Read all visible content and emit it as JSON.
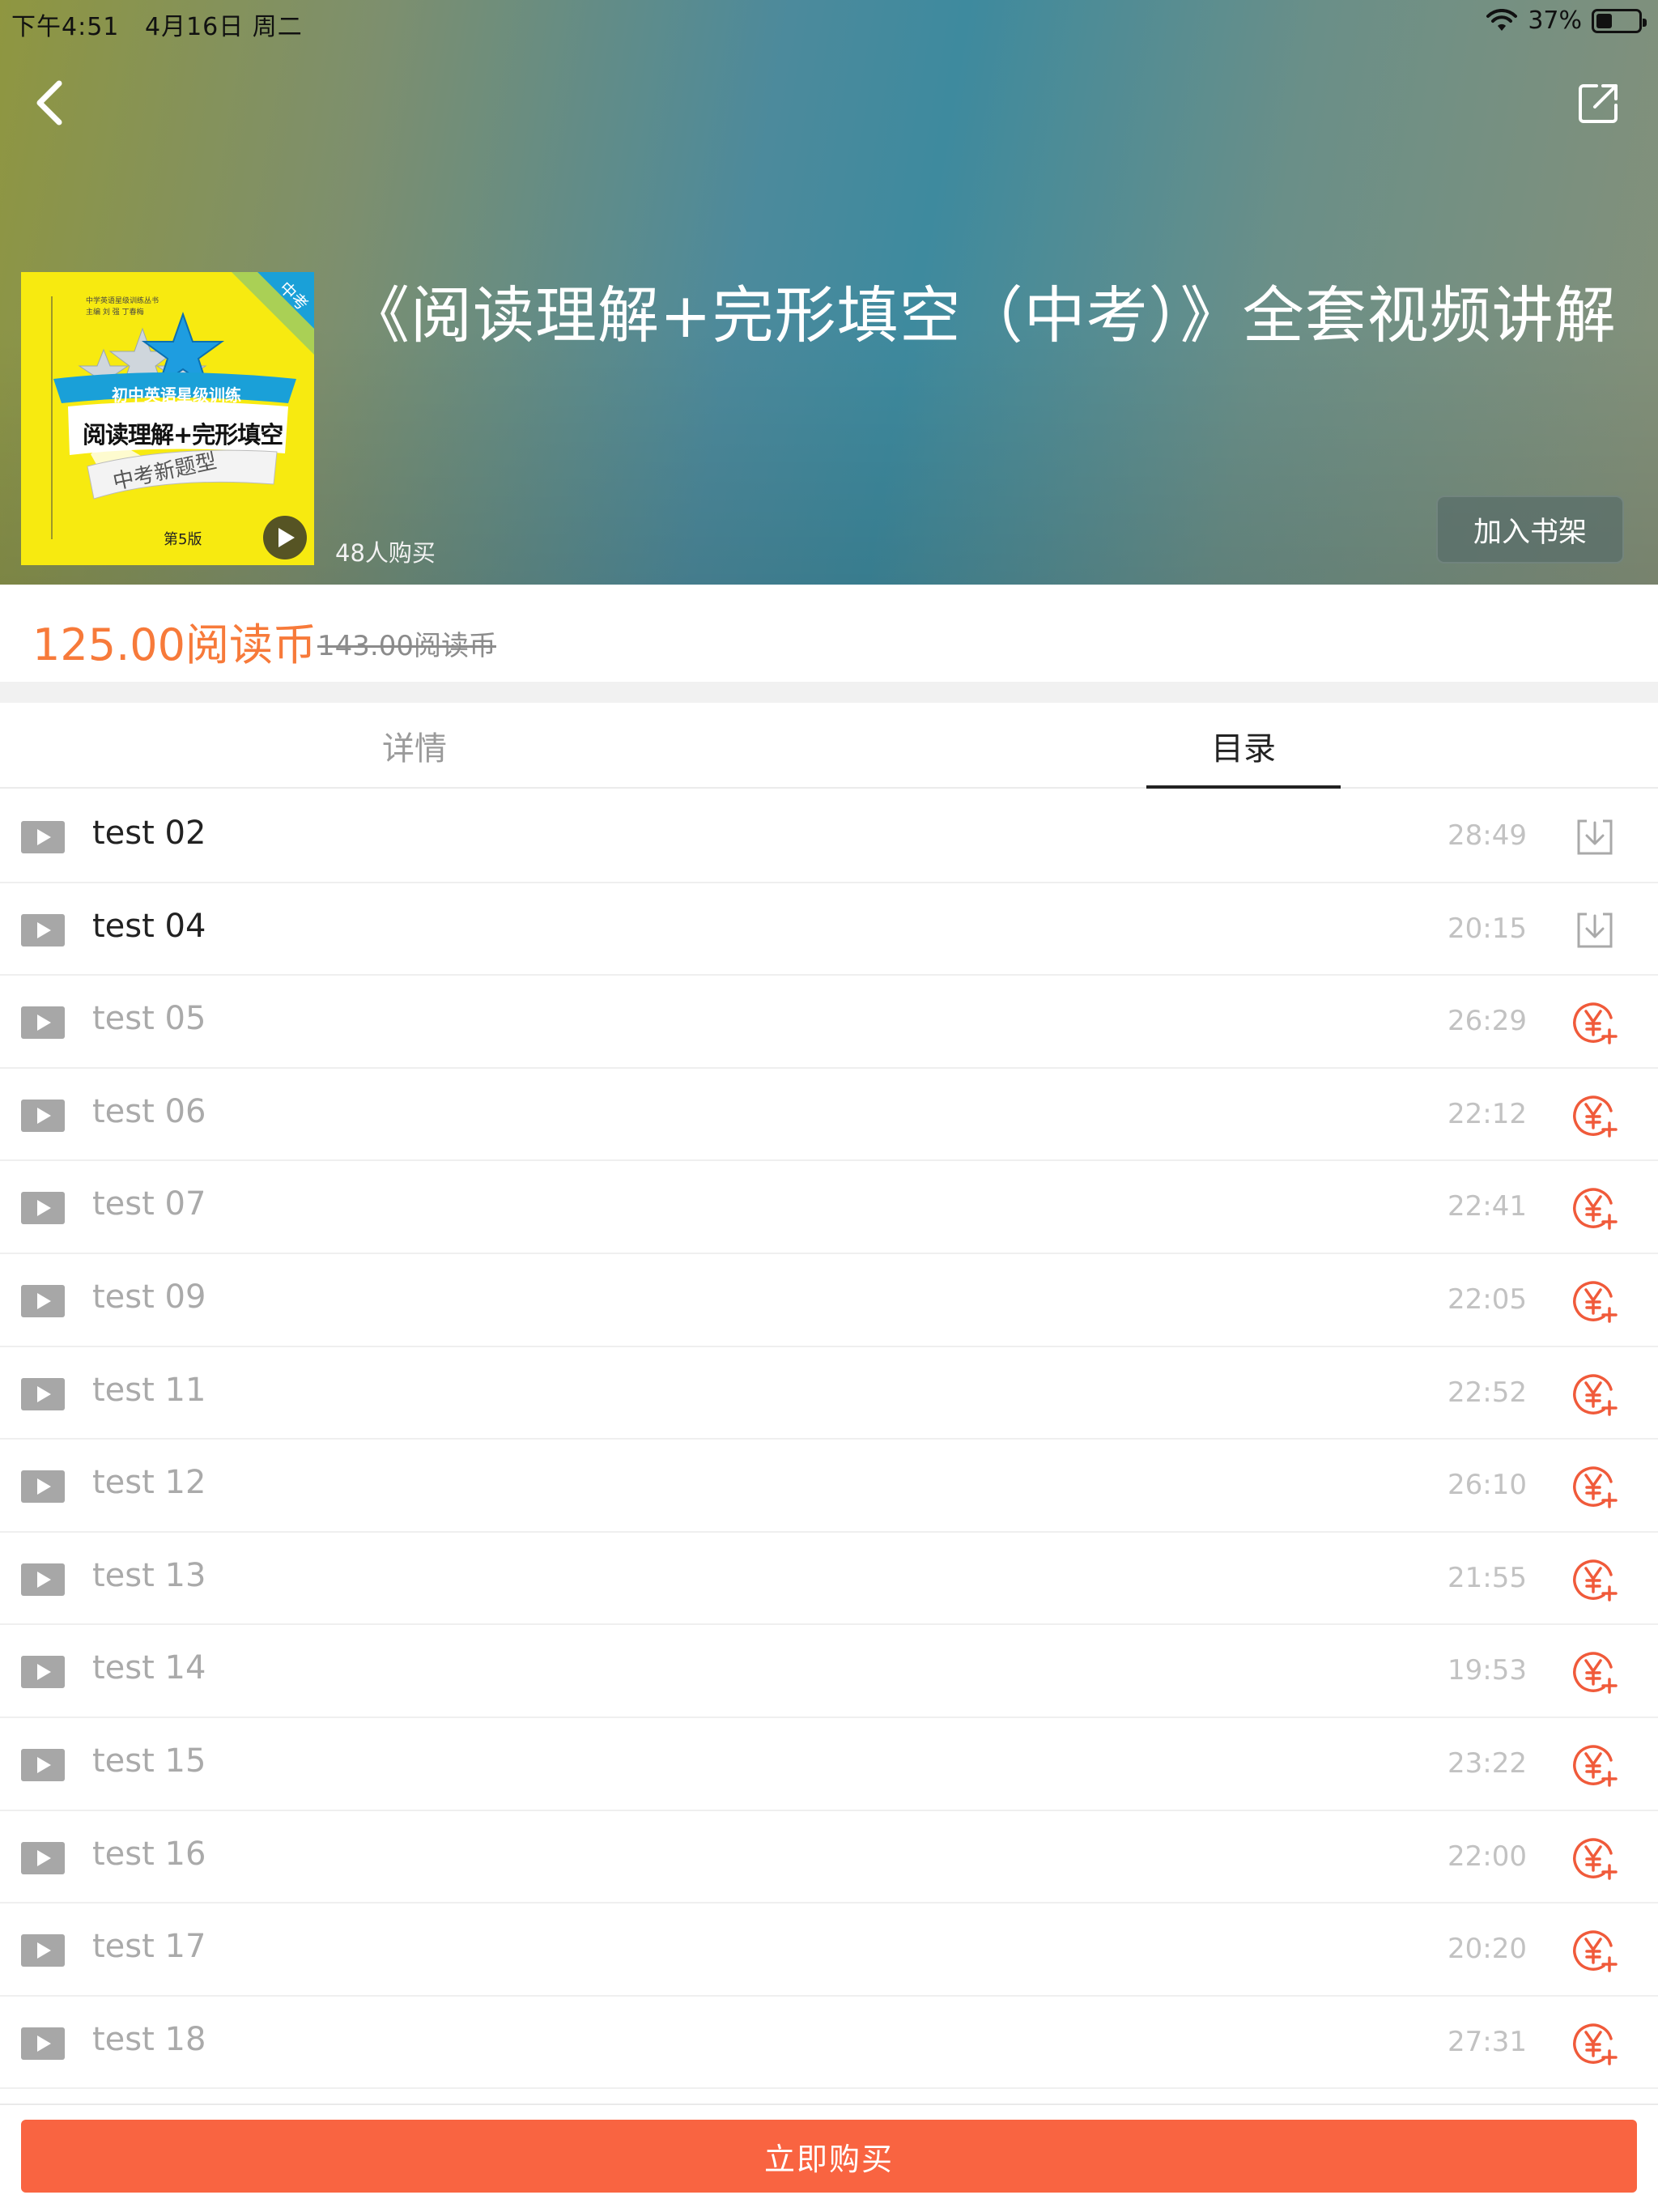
{
  "status_bar": {
    "time": "下午4:51",
    "date": "4月16日 周二",
    "battery": "37%",
    "battery_level": 0.37
  },
  "book": {
    "title": "《阅读理解+完形填空（中考）》全套视频讲解",
    "buyers": "48人购买",
    "add_to_shelf": "加入书架",
    "cover": {
      "corner_tag": "中考",
      "series_top": "中学英语星级训练丛书",
      "editors": "主编 刘 强 丁春梅",
      "subtitle": "初中英语星级训练",
      "main_title": "阅读理解+完形填空",
      "slogan": "中考新题型",
      "edition": "第5版"
    }
  },
  "price": {
    "current": "125.00阅读币",
    "original": "143.00阅读币"
  },
  "tabs": [
    {
      "label": "详情",
      "active": false
    },
    {
      "label": "目录",
      "active": true
    }
  ],
  "episodes": [
    {
      "name": "test 02",
      "duration": "28:49",
      "state": "download"
    },
    {
      "name": "test 04",
      "duration": "20:15",
      "state": "download"
    },
    {
      "name": "test 05",
      "duration": "26:29",
      "state": "buy"
    },
    {
      "name": "test 06",
      "duration": "22:12",
      "state": "buy"
    },
    {
      "name": "test 07",
      "duration": "22:41",
      "state": "buy"
    },
    {
      "name": "test 09",
      "duration": "22:05",
      "state": "buy"
    },
    {
      "name": "test 11",
      "duration": "22:52",
      "state": "buy"
    },
    {
      "name": "test 12",
      "duration": "26:10",
      "state": "buy"
    },
    {
      "name": "test 13",
      "duration": "21:55",
      "state": "buy"
    },
    {
      "name": "test 14",
      "duration": "19:53",
      "state": "buy"
    },
    {
      "name": "test 15",
      "duration": "23:22",
      "state": "buy"
    },
    {
      "name": "test 16",
      "duration": "22:00",
      "state": "buy"
    },
    {
      "name": "test 17",
      "duration": "20:20",
      "state": "buy"
    },
    {
      "name": "test 18",
      "duration": "27:31",
      "state": "buy"
    }
  ],
  "buy_button": "立即购买",
  "colors": {
    "accent": "#f96441",
    "price": "#f77a3a",
    "buy_icon": "#f05a3a"
  }
}
